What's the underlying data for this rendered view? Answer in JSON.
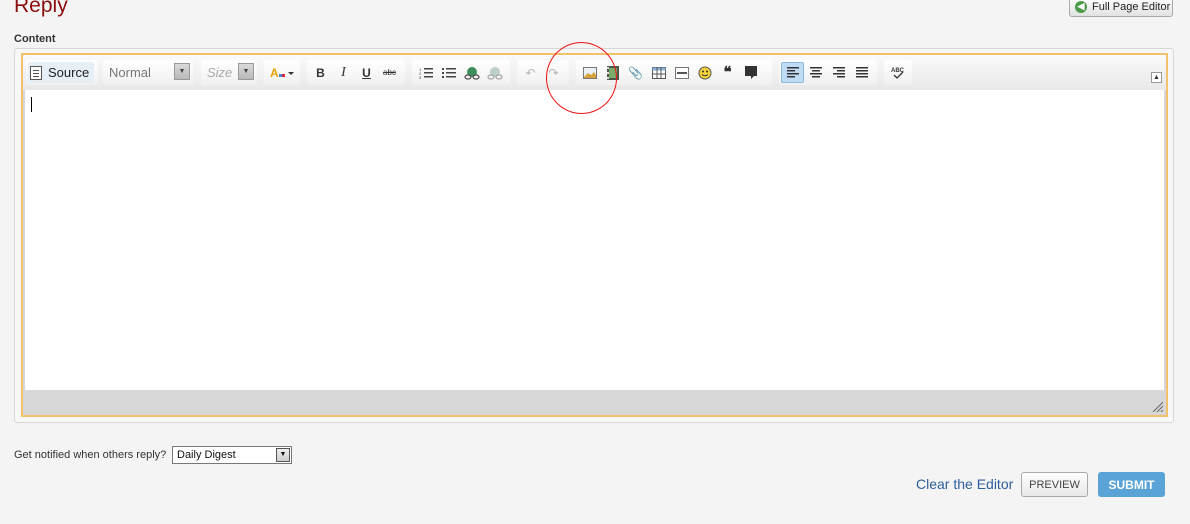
{
  "header": {
    "title": "Reply",
    "full_page_editor_label": "Full Page Editor"
  },
  "editor": {
    "content_label": "Content",
    "source_label": "Source",
    "format_value": "Normal",
    "size_placeholder": "Size",
    "text_value": ""
  },
  "toolbar_icons": [
    "font-color-icon",
    "bold-icon",
    "italic-icon",
    "underline-icon",
    "strikethrough-icon",
    "numbered-list-icon",
    "bullet-list-icon",
    "link-icon",
    "unlink-icon",
    "undo-icon",
    "redo-icon",
    "image-icon",
    "video-icon",
    "attachment-icon",
    "table-icon",
    "horizontal-rule-icon",
    "smiley-icon",
    "blockquote-icon",
    "code-icon",
    "align-left-icon",
    "align-center-icon",
    "align-right-icon",
    "justify-icon",
    "spellcheck-icon"
  ],
  "notify": {
    "label": "Get notified when others reply?",
    "selected": "Daily Digest"
  },
  "actions": {
    "clear_label": "Clear the Editor",
    "preview_label": "PREVIEW",
    "submit_label": "SUBMIT"
  },
  "colors": {
    "title": "#8b0d0d",
    "focus_border": "#f1c16c",
    "submit": "#5aa3d6",
    "link": "#2e5f9c",
    "annotation_circle": "#e11111"
  }
}
